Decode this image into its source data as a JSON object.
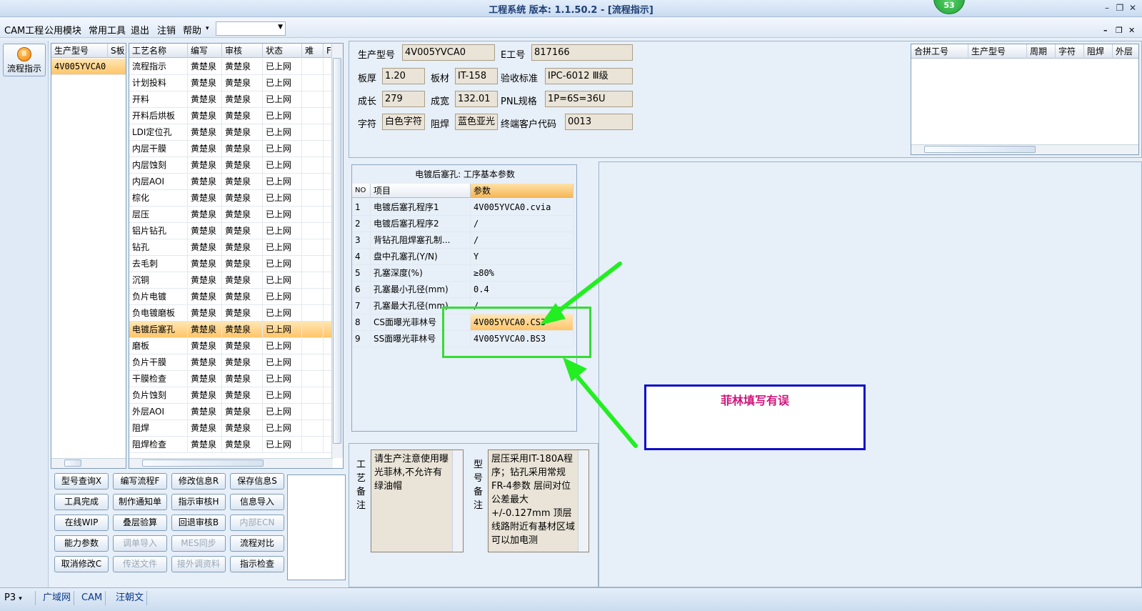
{
  "window": {
    "title": "工程系统  版本: 1.1.50.2 - [流程指示]",
    "badge": "53"
  },
  "menu": {
    "items": [
      "CAM工程",
      "公用模块",
      "常用工具",
      "退出",
      "注销",
      "帮助"
    ],
    "combo_value": ""
  },
  "nav": {
    "flow_label": "流程指示",
    "flow_icon_glyph": "Ⅲ"
  },
  "model_grid": {
    "headers": [
      "生产型号",
      "S板"
    ],
    "rows": [
      "4V005YVCA0"
    ]
  },
  "process_grid": {
    "headers": [
      "工艺名称",
      "编写",
      "审核",
      "状态",
      "难",
      "F"
    ],
    "rows": [
      [
        "流程指示",
        "黄楚泉",
        "黄楚泉",
        "已上网"
      ],
      [
        "计划投料",
        "黄楚泉",
        "黄楚泉",
        "已上网"
      ],
      [
        "开料",
        "黄楚泉",
        "黄楚泉",
        "已上网"
      ],
      [
        "开料后烘板",
        "黄楚泉",
        "黄楚泉",
        "已上网"
      ],
      [
        "LDI定位孔",
        "黄楚泉",
        "黄楚泉",
        "已上网"
      ],
      [
        "内层干膜",
        "黄楚泉",
        "黄楚泉",
        "已上网"
      ],
      [
        "内层蚀刻",
        "黄楚泉",
        "黄楚泉",
        "已上网"
      ],
      [
        "内层AOI",
        "黄楚泉",
        "黄楚泉",
        "已上网"
      ],
      [
        "棕化",
        "黄楚泉",
        "黄楚泉",
        "已上网"
      ],
      [
        "层压",
        "黄楚泉",
        "黄楚泉",
        "已上网"
      ],
      [
        "铝片钻孔",
        "黄楚泉",
        "黄楚泉",
        "已上网"
      ],
      [
        "钻孔",
        "黄楚泉",
        "黄楚泉",
        "已上网"
      ],
      [
        "去毛刺",
        "黄楚泉",
        "黄楚泉",
        "已上网"
      ],
      [
        "沉铜",
        "黄楚泉",
        "黄楚泉",
        "已上网"
      ],
      [
        "负片电镀",
        "黄楚泉",
        "黄楚泉",
        "已上网"
      ],
      [
        "负电镀磨板",
        "黄楚泉",
        "黄楚泉",
        "已上网"
      ],
      [
        "电镀后塞孔",
        "黄楚泉",
        "黄楚泉",
        "已上网"
      ],
      [
        "磨板",
        "黄楚泉",
        "黄楚泉",
        "已上网"
      ],
      [
        "负片干膜",
        "黄楚泉",
        "黄楚泉",
        "已上网"
      ],
      [
        "干膜检查",
        "黄楚泉",
        "黄楚泉",
        "已上网"
      ],
      [
        "负片蚀刻",
        "黄楚泉",
        "黄楚泉",
        "已上网"
      ],
      [
        "外层AOI",
        "黄楚泉",
        "黄楚泉",
        "已上网"
      ],
      [
        "阻焊",
        "黄楚泉",
        "黄楚泉",
        "已上网"
      ],
      [
        "阻焊检查",
        "黄楚泉",
        "黄楚泉",
        "已上网"
      ]
    ],
    "selected_row": 16
  },
  "buttons": [
    [
      "型号查询X",
      "编写流程F",
      "修改信息R",
      "保存信息S"
    ],
    [
      "工具完成",
      "制作通知单",
      "指示审核H",
      "信息导入"
    ],
    [
      "在线WIP",
      "叠层验算",
      "回退审核B",
      "内部ECN"
    ],
    [
      "能力参数",
      "调单导入",
      "MES同步",
      "流程对比"
    ],
    [
      "取消修改C",
      "传送文件",
      "接外调资料",
      "指示检查"
    ]
  ],
  "disabled_buttons": [
    "内部ECN",
    "调单导入",
    "MES同步",
    "传送文件",
    "接外调资料"
  ],
  "info": {
    "part_no_label": "生产型号",
    "part_no": "4V005YVCA0",
    "e_no_label": "E工号",
    "e_no": "817166",
    "thickness_label": "板厚",
    "thickness": "1.20",
    "material_label": "板材",
    "material": "IT-158",
    "standard_label": "验收标准",
    "standard": "IPC-6012 Ⅲ级",
    "length_label": "成长",
    "length": "279",
    "width_label": "成宽",
    "width": "132.01",
    "pnl_label": "PNL规格",
    "pnl": "1P=6S=36U",
    "silk_label": "字符",
    "silk": "白色字符",
    "mask_label": "阻焊",
    "mask": "蓝色亚光",
    "customer_label": "终端客户代码",
    "customer": "0013"
  },
  "combine_grid": {
    "headers": [
      "合拼工号",
      "生产型号",
      "周期",
      "字符",
      "阻焊",
      "外层"
    ]
  },
  "params": {
    "title": "电镀后塞孔: 工序基本参数",
    "headers": [
      "NO",
      "项目",
      "参数"
    ],
    "rows": [
      [
        "1",
        "电镀后塞孔程序1",
        "4V005YVCA0.cvia"
      ],
      [
        "2",
        "电镀后塞孔程序2",
        "/"
      ],
      [
        "3",
        "背钻孔阻焊塞孔制...",
        "/"
      ],
      [
        "4",
        "盘中孔塞孔(Y/N)",
        "Y"
      ],
      [
        "5",
        "孔塞深度(%)",
        "≥80%"
      ],
      [
        "6",
        "孔塞最小孔径(mm)",
        "0.4"
      ],
      [
        "7",
        "孔塞最大孔径(mm)",
        "/"
      ],
      [
        "8",
        "CS面曝光菲林号",
        "4V005YVCA0.CS3"
      ],
      [
        "9",
        "SS面曝光菲林号",
        "4V005YVCA0.BS3"
      ]
    ],
    "selected_row": 7
  },
  "remarks": {
    "process_label": "工艺备注",
    "process_text": "请生产注意使用曝光菲林,不允许有绿油帽",
    "model_label": "型号备注",
    "model_text": "层压采用IT-180A程序；钻孔采用常规FR-4参数 层间对位公差最大+/-0.127mm 顶层线路附近有基材区域可以加电测"
  },
  "annotation": {
    "text": "菲林填写有误",
    "box_color": "#0000cc",
    "text_color": "#d0147a",
    "arrow_color": "#22ee22"
  },
  "status": {
    "p3": "P3",
    "net": "广域网",
    "cam": "CAM",
    "user": "汪朝文"
  }
}
